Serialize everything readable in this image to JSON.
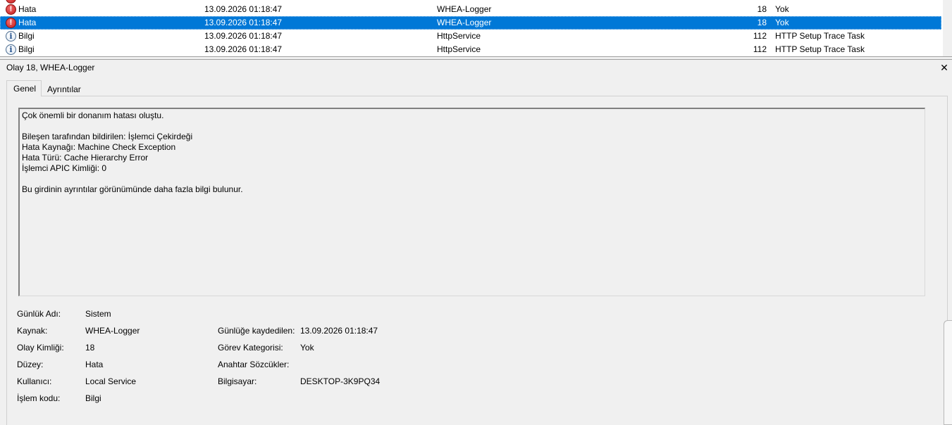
{
  "event_list": {
    "rows": [
      {
        "level": "",
        "date": "",
        "source": "",
        "id": "",
        "task": "",
        "icon": "error-icon"
      },
      {
        "level": "Hata",
        "date": "13.09.2026 01:18:47",
        "source": "WHEA-Logger",
        "id": "18",
        "task": "Yok",
        "icon": "error-icon"
      },
      {
        "level": "Hata",
        "date": "13.09.2026 01:18:47",
        "source": "WHEA-Logger",
        "id": "18",
        "task": "Yok",
        "icon": "error-icon"
      },
      {
        "level": "Bilgi",
        "date": "13.09.2026 01:18:47",
        "source": "HttpService",
        "id": "112",
        "task": "HTTP Setup Trace Task",
        "icon": "info-icon"
      },
      {
        "level": "Bilgi",
        "date": "13.09.2026 01:18:47",
        "source": "HttpService",
        "id": "112",
        "task": "HTTP Setup Trace Task",
        "icon": "info-icon"
      }
    ],
    "selected_index": 2,
    "selection_color": "#0078d7"
  },
  "details": {
    "title": "Olay 18, WHEA-Logger",
    "close_glyph": "✕",
    "tabs": [
      {
        "label": "Genel",
        "active": true
      },
      {
        "label": "Ayrıntılar",
        "active": false
      }
    ],
    "description": [
      "Çok önemli bir donanım hatası oluştu.",
      "",
      "Bileşen tarafından bildirilen: İşlemci Çekirdeği",
      "Hata Kaynağı: Machine Check Exception",
      "Hata Türü: Cache Hierarchy Error",
      "İşlemci APIC Kimliği: 0",
      "",
      "Bu girdinin ayrıntılar görünümünde daha fazla bilgi bulunur."
    ],
    "properties": {
      "log_name_label": "Günlük Adı:",
      "log_name": "Sistem",
      "source_label": "Kaynak:",
      "source": "WHEA-Logger",
      "logged_label": "Günlüğe kaydedilen:",
      "logged": "13.09.2026 01:18:47",
      "event_id_label": "Olay Kimliği:",
      "event_id": "18",
      "task_category_label": "Görev Kategorisi:",
      "task_category": "Yok",
      "level_label": "Düzey:",
      "level": "Hata",
      "keywords_label": "Anahtar Sözcükler:",
      "keywords": "",
      "user_label": "Kullanıcı:",
      "user": "Local Service",
      "computer_label": "Bilgisayar:",
      "computer": "DESKTOP-3K9PQ34",
      "opcode_label": "İşlem kodu:",
      "opcode": "Bilgi"
    }
  }
}
